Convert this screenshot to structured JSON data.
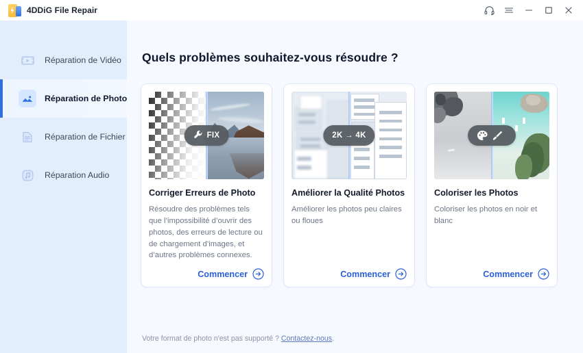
{
  "window": {
    "app_title": "4DDiG File Repair",
    "controls": [
      {
        "name": "support-headset",
        "label": "Support"
      },
      {
        "name": "menu",
        "label": "Menu"
      },
      {
        "name": "minimize",
        "label": "Minimize"
      },
      {
        "name": "maximize",
        "label": "Maximize"
      },
      {
        "name": "close",
        "label": "Close"
      }
    ]
  },
  "colors": {
    "accent": "#2b5fd9",
    "sidebar_bg": "#e2eefc",
    "main_bg": "#f6f9ff",
    "active_bar": "#2f6fe0",
    "card_border": "#dfe6fb",
    "badge_bg": "#555a60",
    "title_text": "#11182a",
    "muted_text": "#6d7586"
  },
  "sidebar": {
    "items": [
      {
        "label": "Réparation de Vidéo",
        "icon": "video-icon",
        "active": false
      },
      {
        "label": "Réparation de Photo",
        "icon": "photo-icon",
        "active": true
      },
      {
        "label": "Réparation de Fichier",
        "icon": "file-icon",
        "active": false
      },
      {
        "label": "Réparation Audio",
        "icon": "audio-icon",
        "active": false
      }
    ]
  },
  "main": {
    "page_title": "Quels problèmes souhaitez-vous résoudre ?",
    "cards": [
      {
        "title": "Corriger Erreurs de Photo",
        "description": "Résoudre des problèmes tels que l’impossibilité d’ouvrir des photos, des erreurs de lecture ou de chargement d’images, et d’autres problèmes connexes.",
        "badge_text": "FIX",
        "badge_icon": "wrench-icon",
        "cta_label": "Commencer",
        "thumb": "checkerboard-to-lake-photo"
      },
      {
        "title": "Améliorer la Qualité Photos",
        "description": "Améliorer les photos peu claires ou floues",
        "badge_text": "2K → 4K",
        "badge_icon": "arrow-right-glyph",
        "cta_label": "Commencer",
        "thumb": "blurry-to-sharp-building-photo"
      },
      {
        "title": "Coloriser les Photos",
        "description": "Coloriser les photos en noir et blanc",
        "badge_text": "",
        "badge_icon": "palette-and-brush-icon",
        "cta_label": "Commencer",
        "thumb": "bw-to-color-beach-photo"
      }
    ],
    "footer": {
      "text": "Votre format de photo n'est pas supporté ?",
      "link_label": "Contactez-nous",
      "suffix": "."
    }
  }
}
